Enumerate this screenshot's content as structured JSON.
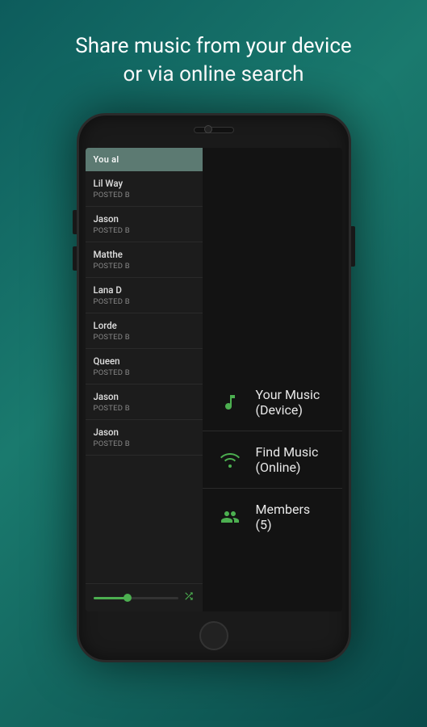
{
  "header": {
    "line1": "Share music from your device",
    "line2": "or via online search"
  },
  "phone": {
    "you_also_label": "You al",
    "songs": [
      {
        "title": "Lil Way",
        "meta": "POSTED B"
      },
      {
        "title": "Jason",
        "meta": "POSTED B"
      },
      {
        "title": "Matthe",
        "meta": "POSTED B"
      },
      {
        "title": "Lana D",
        "meta": "POSTED B"
      },
      {
        "title": "Lorde",
        "meta": "POSTED B"
      },
      {
        "title": "Queen",
        "meta": "POSTED B"
      },
      {
        "title": "Jason",
        "meta": "POSTED B"
      },
      {
        "title": "Jason",
        "meta": "POSTED B"
      }
    ],
    "menu_items": [
      {
        "id": "device-music",
        "label": "Your Music (Device)",
        "icon": "music-note"
      },
      {
        "id": "online-music",
        "label": "Find Music (Online)",
        "icon": "wifi-music"
      },
      {
        "id": "members",
        "label": "Members (5)",
        "icon": "members"
      }
    ]
  }
}
